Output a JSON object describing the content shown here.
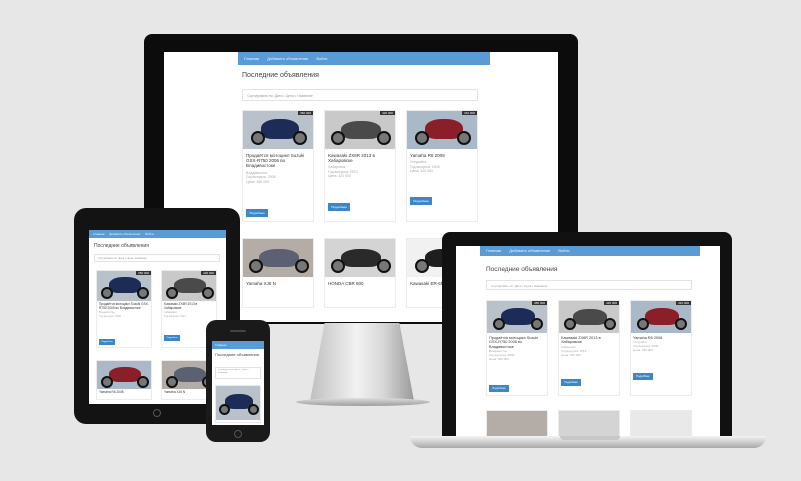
{
  "site": {
    "nav": [
      "Главная",
      "Добавить объявление",
      "Войти"
    ],
    "page_title": "Последние объявления",
    "filter_text": "Сортировать по: Дата • Цена • Название",
    "button_label": "Подробнее"
  },
  "listings": [
    {
      "title": "Продаётся мотоцикл Suzuki GSX-R750 2006 во Владивостоке",
      "meta": [
        "Владивосток",
        "Год выпуска: 2006",
        "Цена: 350 000"
      ],
      "badge": "350 000"
    },
    {
      "title": "Kawasaki ZX6R 2013 в Хабаровске",
      "meta": [
        "Хабаровск",
        "Год выпуска: 2013",
        "Цена: 420 000"
      ],
      "badge": "420 000"
    },
    {
      "title": "Yamaha R6 2008",
      "meta": [
        "Уссурийск",
        "Год выпуска: 2008",
        "Цена: 310 000"
      ],
      "badge": "310 000"
    },
    {
      "title": "Yamaha XJ6 N",
      "meta": [],
      "badge": ""
    },
    {
      "title": "HONDA CBR 600",
      "meta": [],
      "badge": ""
    },
    {
      "title": "Kawasaki ER-6N",
      "meta": [],
      "badge": ""
    }
  ],
  "colors": {
    "accent": "#5a9bd5",
    "button": "#3d87c7"
  }
}
